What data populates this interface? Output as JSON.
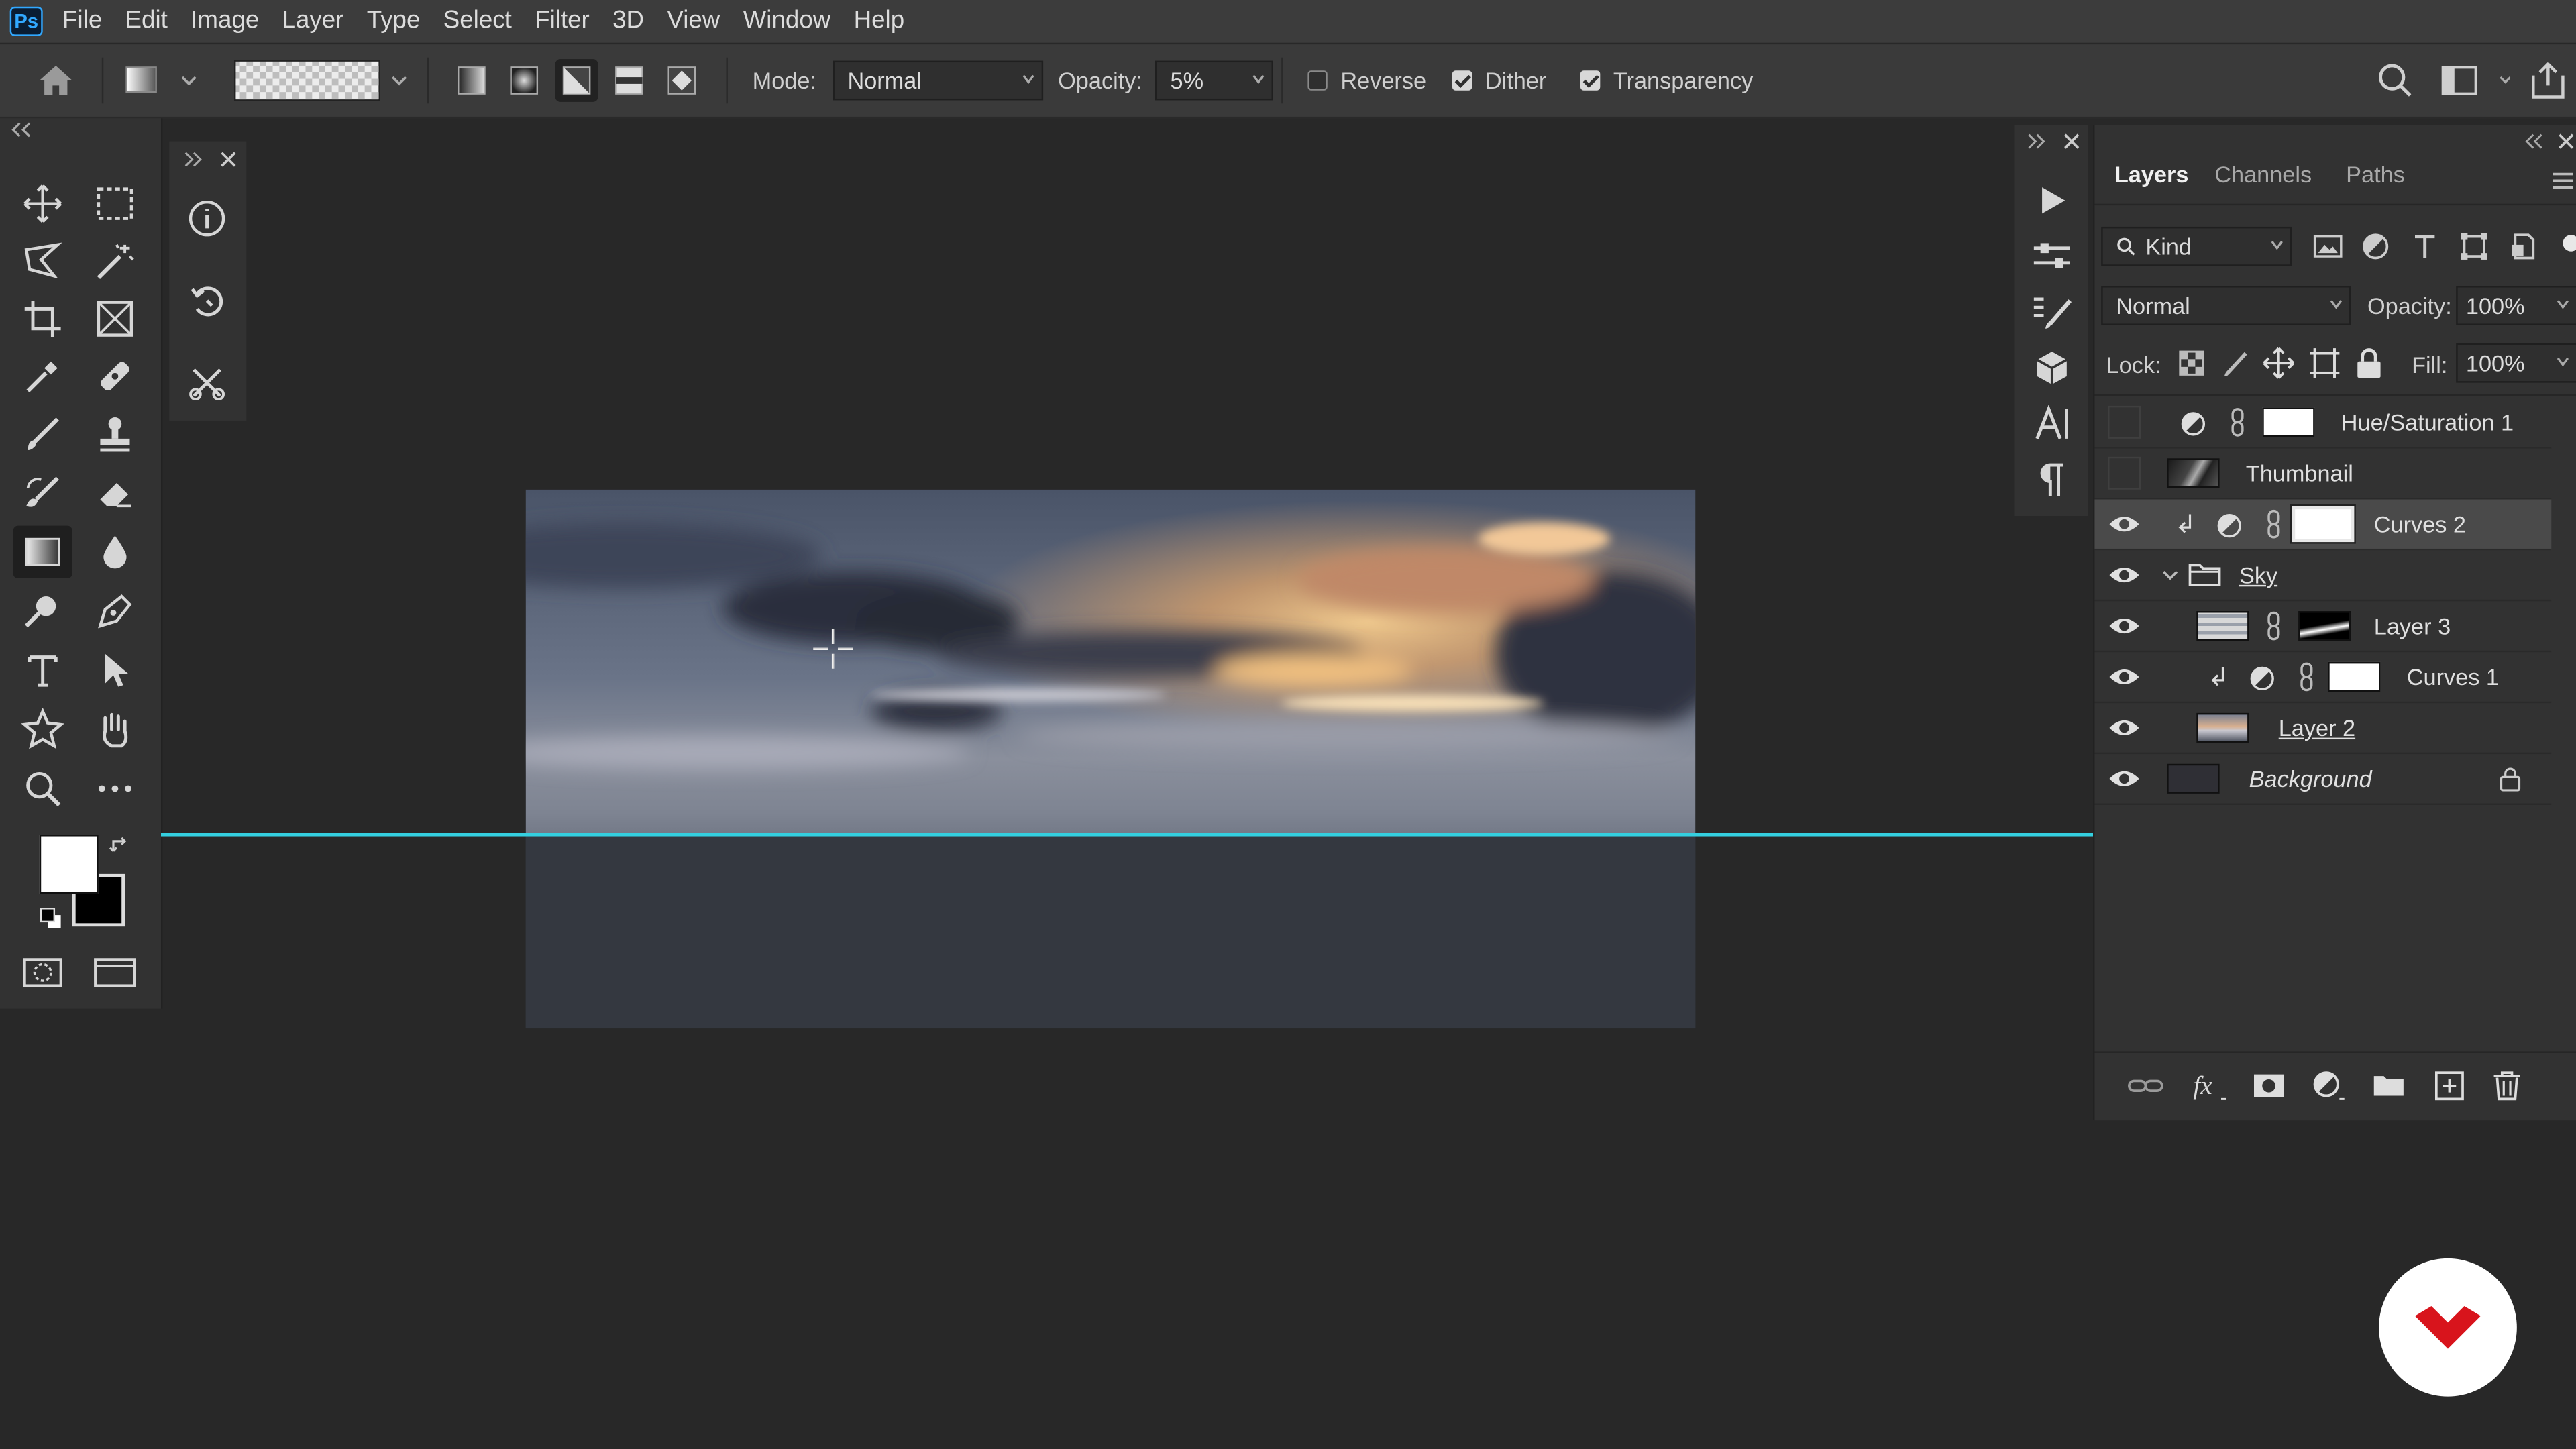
{
  "app": {
    "logo_text": "Ps"
  },
  "menu": [
    "File",
    "Edit",
    "Image",
    "Layer",
    "Type",
    "Select",
    "Filter",
    "3D",
    "View",
    "Window",
    "Help"
  ],
  "options": {
    "mode_label": "Mode:",
    "mode_value": "Normal",
    "opacity_label": "Opacity:",
    "opacity_value": "5%",
    "reverse_label": "Reverse",
    "reverse_checked": false,
    "dither_label": "Dither",
    "dither_checked": true,
    "transparency_label": "Transparency",
    "transparency_checked": true
  },
  "layers_panel": {
    "tabs": [
      "Layers",
      "Channels",
      "Paths"
    ],
    "active_tab": "Layers",
    "filter_value": "Kind",
    "blend_mode": "Normal",
    "opacity_label": "Opacity:",
    "opacity_value": "100%",
    "lock_label": "Lock:",
    "fill_label": "Fill:",
    "fill_value": "100%",
    "layers": [
      {
        "name": "Hue/Saturation 1",
        "visible": false,
        "type": "adjustment"
      },
      {
        "name": "Thumbnail",
        "visible": false,
        "type": "image"
      },
      {
        "name": "Curves 2",
        "visible": true,
        "type": "adjustment",
        "clipped": true,
        "selected": true
      },
      {
        "name": "Sky",
        "visible": true,
        "type": "group"
      },
      {
        "name": "Layer 3",
        "visible": true,
        "type": "image-mask"
      },
      {
        "name": "Curves 1",
        "visible": true,
        "type": "adjustment",
        "clipped": true
      },
      {
        "name": "Layer 2",
        "visible": true,
        "type": "image"
      },
      {
        "name": "Background",
        "visible": true,
        "type": "background",
        "locked": true
      }
    ]
  },
  "colors": {
    "accent_blue": "#31a8ff",
    "guide_cyan": "#34d0e0",
    "badge_red": "#d8141c"
  }
}
